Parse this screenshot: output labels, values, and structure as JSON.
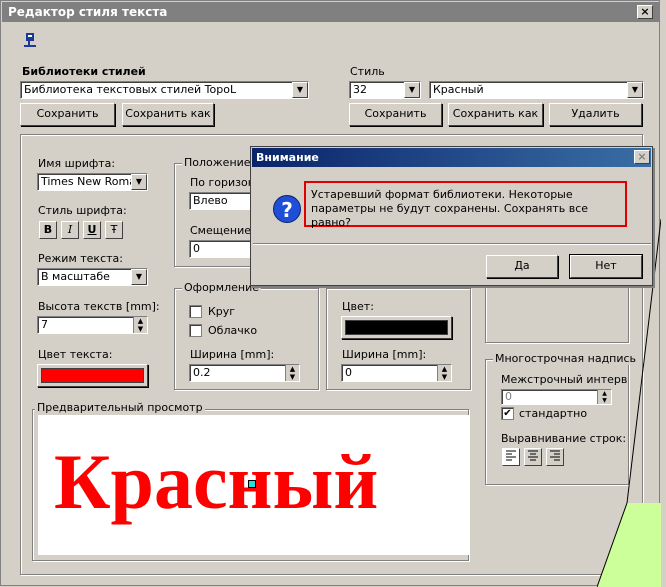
{
  "window": {
    "title": "Редактор стиля текста",
    "close": "×"
  },
  "libraries": {
    "heading": "Библиотеки стилей",
    "selected": "Библиотека текстовых стилей TopoL",
    "save": "Сохранить",
    "save_as": "Сохранить как"
  },
  "style": {
    "heading": "Стиль",
    "number": "32",
    "name": "Красный",
    "save": "Сохранить",
    "save_as": "Сохранить как",
    "delete": "Удалить"
  },
  "font": {
    "name_label": "Имя шрифта:",
    "name_value": "Times New Roman",
    "style_label": "Стиль шрифта:",
    "style_buttons": [
      "B",
      "I",
      "U",
      "Ŧ"
    ],
    "mode_label": "Режим текста:",
    "mode_value": "В масштабе",
    "height_label": "Высота текств [mm]:",
    "height_value": "7",
    "color_label": "Цвет текста:",
    "color": "#ff0000"
  },
  "position": {
    "heading": "Положение н",
    "horiz_label": "По горизонт",
    "horiz_value": "Влево",
    "offset_label": "Смещение [",
    "offset_value": "0"
  },
  "decoration": {
    "heading": "Оформление",
    "circle": "Круг",
    "cloud": "Облачко",
    "width_label": "Ширина [mm]:",
    "width_value": "0.2"
  },
  "frame": {
    "color_label": "Цвет:",
    "color": "#000000",
    "width_label": "Ширина [mm]:",
    "width_value": "0"
  },
  "multiline": {
    "heading": "Многострочная надпись",
    "spacing_label": "Межстрочный интервал [",
    "spacing_value": "0",
    "standard_label": "стандартно",
    "align_label": "Выравнивание строк:"
  },
  "preview": {
    "heading": "Предварительный просмотр",
    "text": "Красный",
    "color": "#ff0000"
  },
  "dialog": {
    "title": "Внимание",
    "message": "Устаревший формат библиотеки. Некоторые параметры не будут сохранены. Сохранять все равно?",
    "yes": "Да",
    "no": "Нет",
    "icon": "?"
  }
}
